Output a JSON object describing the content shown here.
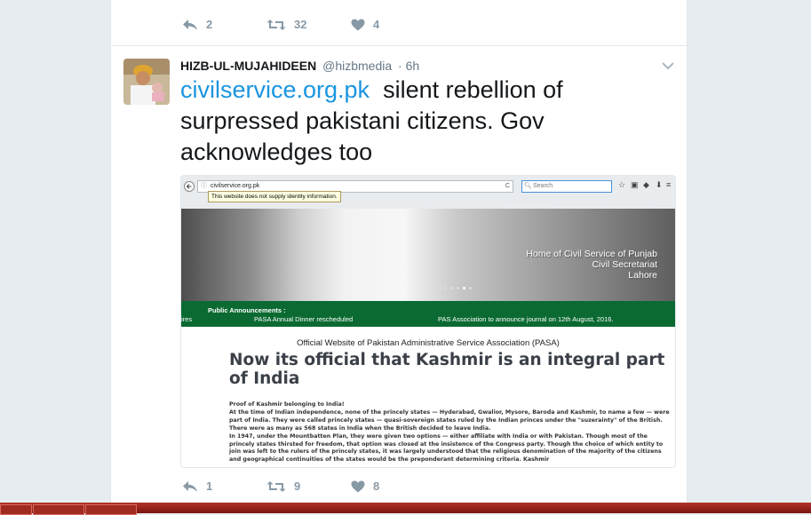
{
  "top_actions": {
    "reply_count": "2",
    "retweet_count": "32",
    "like_count": "4"
  },
  "tweet": {
    "display_name": "HIZB-UL-MUJAHIDEEN",
    "handle": "@hizbmedia",
    "time": "· 6h",
    "link_text": "civilservice.org.pk",
    "body_text": "  silent rebellion of surpressed pakistani citizens. Gov acknowledges too"
  },
  "screenshot": {
    "url": "civilservice.org.pk",
    "search_placeholder": "Search",
    "tooltip": "This website does not supply identity information.",
    "hero_lines": [
      "Home of Civil Service of Punjab",
      "Civil Secretariat",
      "Lahore"
    ],
    "announcements_label": "Public Announcements :",
    "announcements": [
      "ires",
      "PASA Annual Dinner rescheduled",
      "PAS Association to announce journal on 12th August, 2016."
    ],
    "site_title": "Official Website of Pakistan Administrative Service Association (PASA)",
    "headline": "Now its official that Kashmir is an integral part of India",
    "body_heading": "Proof of Kashmir belonging to India!",
    "body_paragraphs": [
      "At the time of Indian independence, none of the princely states — Hyderabad, Gwalior, Mysore, Baroda and Kashmir, to name a few — were part of India. They were called princely states — quasi-sovereign states ruled by the Indian princes under the \"suzerainty\" of the British. There were as many as 568 states in India when the British decided to leave India.",
      "In 1947, under the Mountbatten Plan, they were given two options — either affiliate with India or with Pakistan. Though most of the princely states thirsted for freedom, that option was closed at the insistence of the Congress party. Though the choice of which entity to join was left to the rulers of the princely states, it was largely understood that the religious denomination of the majority of the citizens and geographical continuities of the states would be the preponderant determining criteria. Kashmir"
    ]
  },
  "bottom_actions": {
    "reply_count": "1",
    "retweet_count": "9",
    "like_count": "8"
  },
  "colors": {
    "link": "#1b95e0",
    "icon": "#8899a6",
    "announcement_bar": "#0b6a31",
    "taskbar": "#9b2219"
  }
}
